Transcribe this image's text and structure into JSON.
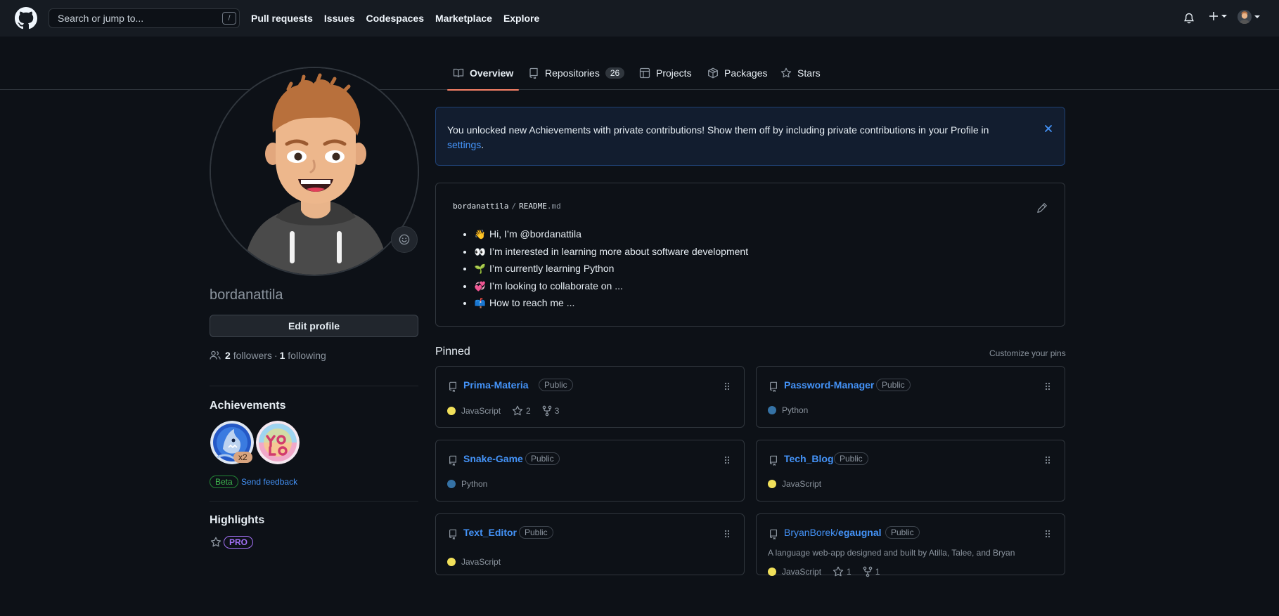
{
  "header": {
    "search_placeholder": "Search or jump to...",
    "search_shortcut": "/",
    "nav": [
      "Pull requests",
      "Issues",
      "Codespaces",
      "Marketplace",
      "Explore"
    ]
  },
  "tabs": [
    {
      "label": "Overview",
      "icon": "book-icon",
      "active": true
    },
    {
      "label": "Repositories",
      "icon": "repo-icon",
      "count": "26"
    },
    {
      "label": "Projects",
      "icon": "table-icon"
    },
    {
      "label": "Packages",
      "icon": "package-icon"
    },
    {
      "label": "Stars",
      "icon": "star-icon"
    }
  ],
  "profile": {
    "username": "bordanattila",
    "edit_button": "Edit profile",
    "followers_count": "2",
    "followers_label": "followers",
    "separator": "·",
    "following_count": "1",
    "following_label": "following"
  },
  "achievements": {
    "heading": "Achievements",
    "badge_count": "x2",
    "beta_label": "Beta",
    "feedback_link": "Send feedback"
  },
  "highlights": {
    "heading": "Highlights",
    "pro_label": "PRO"
  },
  "banner": {
    "text": "You unlocked new Achievements with private contributions! Show them off by including private contributions in your Profile in",
    "link": "settings",
    "end": "."
  },
  "readme": {
    "owner": "bordanattila",
    "slash": "/",
    "file": "README",
    "ext": ".md",
    "items": [
      {
        "emoji": "👋",
        "text": "Hi, I’m @bordanattila"
      },
      {
        "emoji": "👀",
        "text": "I’m interested in learning more about software development"
      },
      {
        "emoji": "🌱",
        "text": "I’m currently learning Python"
      },
      {
        "emoji": "💞",
        "text": "I’m looking to collaborate on ..."
      },
      {
        "emoji": "📫",
        "text": "How to reach me ..."
      }
    ]
  },
  "pinned": {
    "title": "Pinned",
    "customize": "Customize your pins",
    "repos": [
      {
        "name": "Prima-Materia",
        "visibility": "Public",
        "language": "JavaScript",
        "lang_color": "#f1e05a",
        "stars": "2",
        "forks": "3",
        "description": ""
      },
      {
        "name": "Password-Manager",
        "visibility": "Public",
        "language": "Python",
        "lang_color": "#3572a5",
        "stars": "",
        "forks": "",
        "description": ""
      },
      {
        "name": "Snake-Game",
        "visibility": "Public",
        "language": "Python",
        "lang_color": "#3572a5",
        "stars": "",
        "forks": "",
        "description": ""
      },
      {
        "name": "Tech_Blog",
        "visibility": "Public",
        "language": "JavaScript",
        "lang_color": "#f1e05a",
        "stars": "",
        "forks": "",
        "description": ""
      },
      {
        "name": "Text_Editor",
        "visibility": "Public",
        "language": "JavaScript",
        "lang_color": "#f1e05a",
        "stars": "",
        "forks": "",
        "description": ""
      },
      {
        "name": "BryanBorek/egaugnal",
        "visibility": "Public",
        "language": "JavaScript",
        "lang_color": "#f1e05a",
        "stars": "1",
        "forks": "1",
        "description": "A language web-app designed and built by Atilla, Talee, and Bryan"
      }
    ]
  },
  "colors": {
    "accent_link": "#4493f8",
    "tab_underline": "#f78166",
    "background": "#0d1117"
  }
}
